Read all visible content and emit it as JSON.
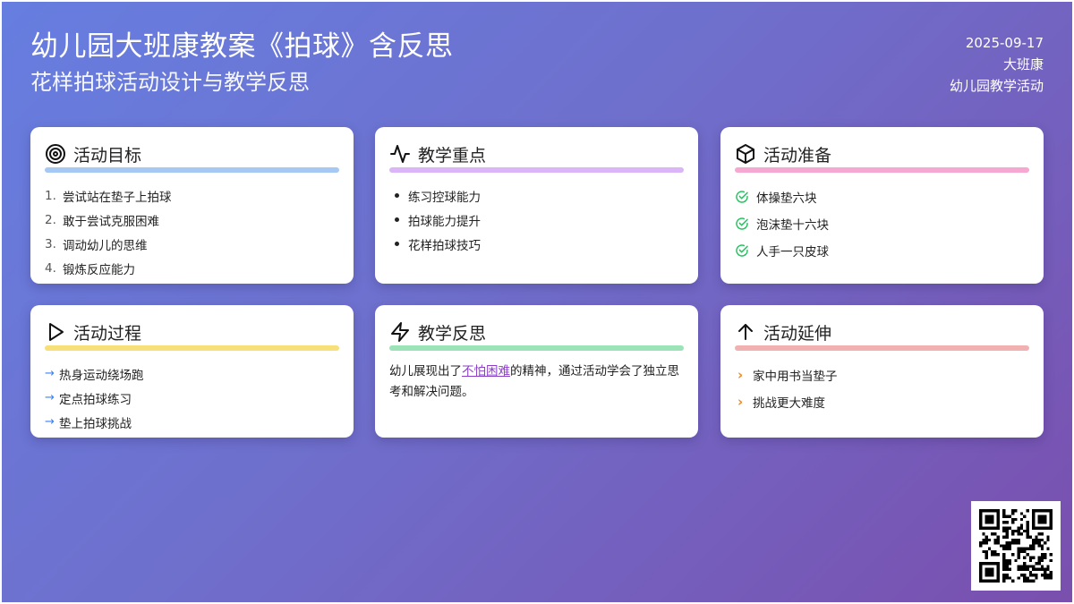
{
  "header": {
    "title": "幼儿园大班康教案《拍球》含反思",
    "subtitle": "花样拍球活动设计与教学反思",
    "date": "2025-09-17",
    "class": "大班康",
    "category": "幼儿园教学活动"
  },
  "cards": {
    "goals": {
      "title": "活动目标",
      "icon": "target-icon",
      "color": "#a5c8f5",
      "items": [
        "尝试站在垫子上拍球",
        "敢于尝试克服困难",
        "调动幼儿的思维",
        "锻炼反应能力"
      ],
      "numbers": [
        "1.",
        "2.",
        "3.",
        "4."
      ]
    },
    "focus": {
      "title": "教学重点",
      "icon": "activity-pulse-icon",
      "color": "#dab6f8",
      "items": [
        "练习控球能力",
        "拍球能力提升",
        "花样拍球技巧"
      ]
    },
    "prep": {
      "title": "活动准备",
      "icon": "box-icon",
      "color": "#f6a8d2",
      "items": [
        "体操垫六块",
        "泡沫垫十六块",
        "人手一只皮球"
      ]
    },
    "process": {
      "title": "活动过程",
      "icon": "play-icon",
      "color": "#f7e07a",
      "arrow": "→",
      "items": [
        "热身运动绕场跑",
        "定点拍球练习",
        "垫上拍球挑战"
      ]
    },
    "reflection": {
      "title": "教学反思",
      "icon": "lightning-icon",
      "color": "#9ce4b8",
      "text_before": "幼儿展现出了",
      "highlight": "不怕困难",
      "text_after": "的精神，通过活动学会了独立思考和解决问题。"
    },
    "extension": {
      "title": "活动延伸",
      "icon": "arrow-up-icon",
      "color": "#f2b1b1",
      "chevron": "›",
      "items": [
        "家中用书当垫子",
        "挑战更大难度"
      ]
    }
  },
  "colors": {
    "accent_check": "#22c55e",
    "accent_arrow": "#3b82f6",
    "accent_chevron": "#f08a24",
    "highlight": "#8b3fc7"
  },
  "qr": {
    "icon": "qr-code-icon"
  }
}
